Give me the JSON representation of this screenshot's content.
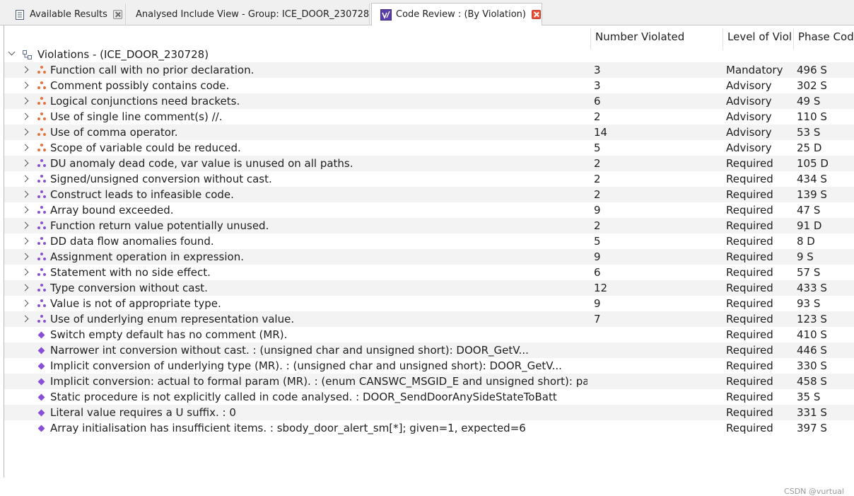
{
  "tabs": [
    {
      "label": "Available Results",
      "icon": "results-list-icon",
      "active": false
    },
    {
      "label": "Analysed Include View - Group: ICE_DOOR_230728",
      "icon": "",
      "active": false
    },
    {
      "label": "Code Review : (By Violation)",
      "icon": "code-review-icon",
      "active": true
    }
  ],
  "columns": {
    "number_violated": "Number Violated",
    "level": "Level of Viol",
    "phase_code": "Phase Code"
  },
  "root": {
    "label": "Violations - (ICE_DOOR_230728)"
  },
  "colors": {
    "advisory": "#e8703a",
    "required": "#8a4fd8",
    "close_active": "#e8503a"
  },
  "rows": [
    {
      "name": "Function call with no prior declaration.",
      "count": "3",
      "level": "Mandatory",
      "phase": "496 S",
      "expandable": true,
      "kind": "advisory"
    },
    {
      "name": "Comment possibly contains code.",
      "count": "3",
      "level": "Advisory",
      "phase": "302 S",
      "expandable": true,
      "kind": "advisory"
    },
    {
      "name": "Logical conjunctions need brackets.",
      "count": "6",
      "level": "Advisory",
      "phase": "49 S",
      "expandable": true,
      "kind": "advisory"
    },
    {
      "name": "Use of single line comment(s) //.",
      "count": "2",
      "level": "Advisory",
      "phase": "110 S",
      "expandable": true,
      "kind": "advisory"
    },
    {
      "name": "Use of comma operator.",
      "count": "14",
      "level": "Advisory",
      "phase": "53 S",
      "expandable": true,
      "kind": "advisory"
    },
    {
      "name": "Scope of variable could be reduced.",
      "count": "5",
      "level": "Advisory",
      "phase": "25 D",
      "expandable": true,
      "kind": "advisory"
    },
    {
      "name": "DU anomaly dead code, var value is unused on all paths.",
      "count": "2",
      "level": "Required",
      "phase": "105 D",
      "expandable": true,
      "kind": "required"
    },
    {
      "name": "Signed/unsigned conversion without cast.",
      "count": "2",
      "level": "Required",
      "phase": "434 S",
      "expandable": true,
      "kind": "required"
    },
    {
      "name": "Construct leads to infeasible code.",
      "count": "2",
      "level": "Required",
      "phase": "139 S",
      "expandable": true,
      "kind": "required"
    },
    {
      "name": "Array bound exceeded.",
      "count": "9",
      "level": "Required",
      "phase": "47 S",
      "expandable": true,
      "kind": "required"
    },
    {
      "name": "Function return value potentially unused.",
      "count": "2",
      "level": "Required",
      "phase": "91 D",
      "expandable": true,
      "kind": "required"
    },
    {
      "name": "DD data flow anomalies found.",
      "count": "5",
      "level": "Required",
      "phase": "8 D",
      "expandable": true,
      "kind": "required"
    },
    {
      "name": "Assignment operation in expression.",
      "count": "9",
      "level": "Required",
      "phase": "9 S",
      "expandable": true,
      "kind": "required"
    },
    {
      "name": "Statement with no side effect.",
      "count": "6",
      "level": "Required",
      "phase": "57 S",
      "expandable": true,
      "kind": "required"
    },
    {
      "name": "Type conversion without cast.",
      "count": "12",
      "level": "Required",
      "phase": "433 S",
      "expandable": true,
      "kind": "required"
    },
    {
      "name": "Value is not of appropriate type.",
      "count": "9",
      "level": "Required",
      "phase": "93 S",
      "expandable": true,
      "kind": "required"
    },
    {
      "name": "Use of underlying enum representation value.",
      "count": "7",
      "level": "Required",
      "phase": "123 S",
      "expandable": true,
      "kind": "required"
    },
    {
      "name": "Switch empty default has no comment (MR).",
      "count": "",
      "level": "Required",
      "phase": "410 S",
      "expandable": false,
      "kind": "leaf"
    },
    {
      "name": "Narrower int conversion without cast. : (unsigned char and unsigned short): DOOR_GetV...",
      "count": "",
      "level": "Required",
      "phase": "446 S",
      "expandable": false,
      "kind": "leaf"
    },
    {
      "name": "Implicit conversion of underlying type (MR). : (unsigned char and unsigned short): DOOR_GetV...",
      "count": "",
      "level": "Required",
      "phase": "330 S",
      "expandable": false,
      "kind": "leaf"
    },
    {
      "name": "Implicit conversion: actual to formal param (MR). : (enum CANSWC_MSGID_E and unsigned short): par...",
      "count": "",
      "level": "Required",
      "phase": "458 S",
      "expandable": false,
      "kind": "leaf"
    },
    {
      "name": "Static procedure is not explicitly called in code analysed. : DOOR_SendDoorAnySideStateToBatt",
      "count": "",
      "level": "Required",
      "phase": "35 S",
      "expandable": false,
      "kind": "leaf"
    },
    {
      "name": "Literal value requires a U suffix. : 0",
      "count": "",
      "level": "Required",
      "phase": "331 S",
      "expandable": false,
      "kind": "leaf"
    },
    {
      "name": "Array initialisation has insufficient items. : sbody_door_alert_sm[*]; given=1, expected=6",
      "count": "",
      "level": "Required",
      "phase": "397 S",
      "expandable": false,
      "kind": "leaf"
    }
  ],
  "watermark": "CSDN @vurtual"
}
